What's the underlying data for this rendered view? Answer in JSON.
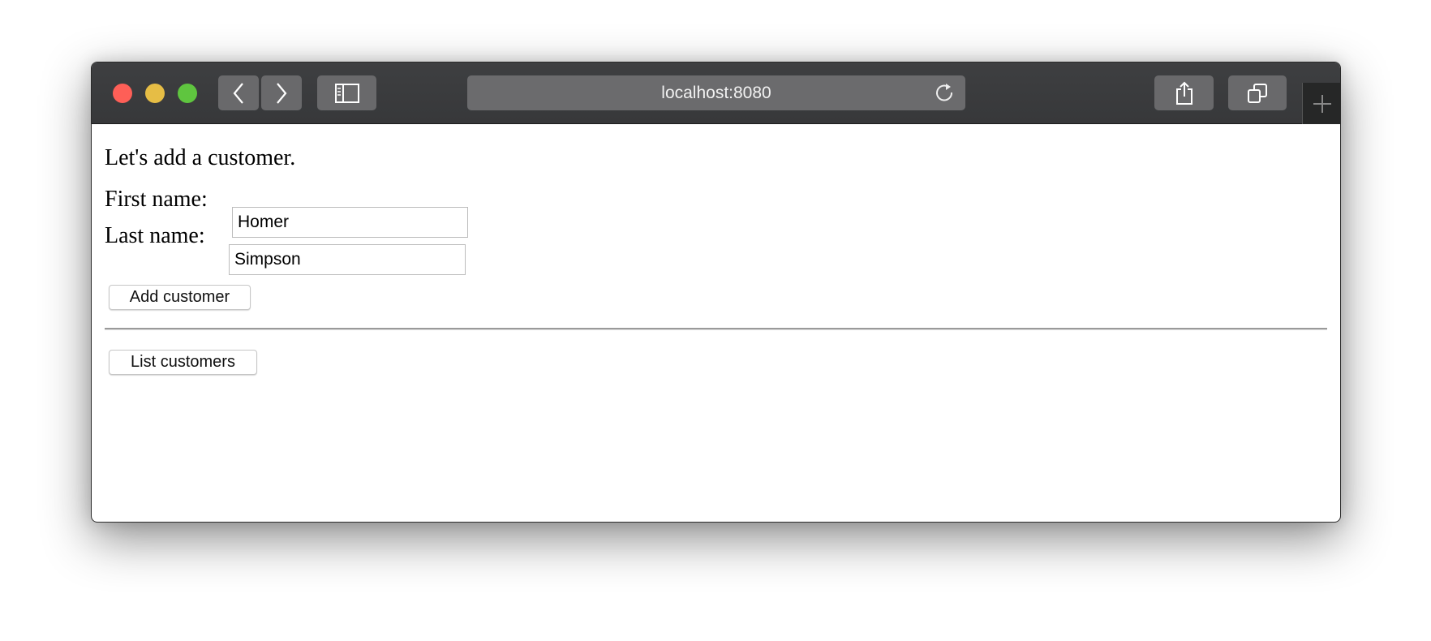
{
  "browser": {
    "url": "localhost:8080",
    "icons": {
      "close": "traffic-light-close",
      "minimize": "traffic-light-minimize",
      "zoom": "traffic-light-zoom",
      "back": "chevron-left-icon",
      "forward": "chevron-right-icon",
      "sidebar": "sidebar-icon",
      "reload": "reload-icon",
      "share": "share-icon",
      "tabs": "tabs-icon",
      "new_tab": "plus-icon"
    },
    "colors": {
      "close": "#fe5f57",
      "minimize": "#e6bd45",
      "zoom": "#5fc53f"
    }
  },
  "page": {
    "heading": "Let's add a customer.",
    "first_name_label": "First name:",
    "first_name_value": "Homer",
    "last_name_label": "Last name:",
    "last_name_value": "Simpson",
    "add_button": "Add customer",
    "list_button": "List customers"
  }
}
